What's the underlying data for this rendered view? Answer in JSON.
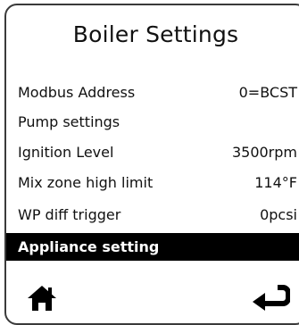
{
  "screen": {
    "title": "Boiler Settings"
  },
  "menu": {
    "items": [
      {
        "label": "Modbus Address",
        "value": "0=BCST"
      },
      {
        "label": "Pump settings",
        "value": ""
      },
      {
        "label": "Ignition Level",
        "value": "3500rpm"
      },
      {
        "label": "Mix zone high limit",
        "value": "114°F"
      },
      {
        "label": "WP diff trigger",
        "value": "0pcsi"
      },
      {
        "label": "Appliance setting",
        "value": ""
      }
    ],
    "selected_index": 5
  },
  "footer": {
    "left_icon": "home-icon",
    "right_icon": "back-icon"
  }
}
